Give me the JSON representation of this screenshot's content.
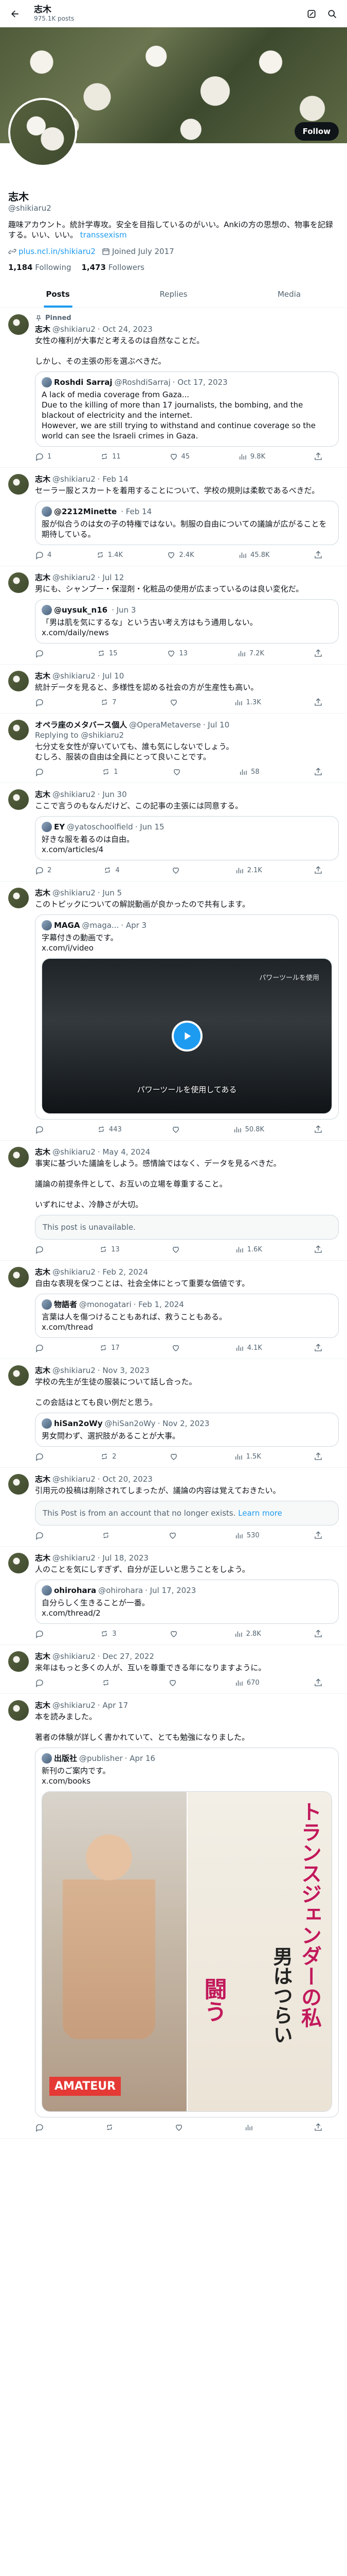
{
  "header": {
    "name": "志木",
    "posts_count": "975.1K posts"
  },
  "profile": {
    "name": "志木",
    "handle": "@shikiaru2",
    "follow_label": "Follow",
    "bio": "趣味アカウント。統計学専攻。安全を目指しているのがいい。Ankiの方の思想の、物事を記録する。いい、いい。",
    "bio_link": "transsexism",
    "website": "plus.ncl.in/shikiaru2",
    "joined": "Joined July 2017",
    "following": "1,184",
    "following_label": "Following",
    "followers": "1,473",
    "followers_label": "Followers"
  },
  "tabs": [
    {
      "label": "Posts"
    },
    {
      "label": "Replies"
    },
    {
      "label": "Media"
    }
  ],
  "tweets": [
    {
      "pinned": "Pinned",
      "name": "志木",
      "handle": "@shikiaru2",
      "date": "· Oct 24, 2023",
      "text": "女性の権利が大事だと考えるのは自然なことだ。\n\nしかし、その主張の形を選ぶべきだ。",
      "quote": {
        "name": "Roshdi Sarraj",
        "handle": "@RoshdiSarraj",
        "date": "· Oct 17, 2023",
        "text": "A lack of media coverage from Gaza...\nDue to the killing of more than 17 journalists, the bombing, and the blackout of electricity and the internet.\nHowever, we are still trying to withstand and continue coverage so the world can see the Israeli crimes in Gaza."
      },
      "stats": [
        "1",
        "11",
        "45",
        "9.8K"
      ]
    },
    {
      "name": "志木",
      "handle": "@shikiaru2",
      "date": "· Feb 14",
      "text": "セーラー服とスカートを着用することについて、学校の規則は柔軟であるべきだ。",
      "quote": {
        "name": "@2212Minette",
        "handle": "",
        "date": "· Feb 14",
        "text": "服が似合うのは女の子の特権ではない。制服の自由についての議論が広がることを期待している。"
      },
      "stats": [
        "4",
        "1.4K",
        "2.4K",
        "45.8K"
      ]
    },
    {
      "name": "志木",
      "handle": "@shikiaru2",
      "date": "· Jul 12",
      "text": "男にも、シャンプー・保湿剤・化粧品の使用が広まっているのは良い変化だ。",
      "quote": {
        "name": "@uysuk_n16",
        "handle": "",
        "date": "· Jun 3",
        "text": "「男は肌を気にするな」という古い考え方はもう通用しない。\nx.com/daily/news"
      },
      "stats": [
        "",
        "15",
        "13",
        "7.2K"
      ]
    },
    {
      "name": "志木",
      "handle": "@shikiaru2",
      "date": "· Jul 10",
      "text": "統計データを見ると、多様性を認める社会の方が生産性も高い。",
      "stats": [
        "",
        "7",
        "",
        "1.3K"
      ]
    },
    {
      "name": "オペラ座のメタバース個人",
      "handle": "@OperaMetaverse",
      "date": "· Jul 10",
      "replying": "Replying to @shikiaru2",
      "text": "七分丈を女性が穿いていても、誰も気にしないでしょう。\nむしろ、服装の自由は全員にとって良いことです。",
      "stats": [
        "",
        "1",
        "",
        "58"
      ]
    },
    {
      "name": "志木",
      "handle": "@shikiaru2",
      "date": "· Jun 30",
      "text": "ここで言うのもなんだけど、この記事の主張には同意する。",
      "quote": {
        "name": "EY",
        "handle": "@yatoschoolfield",
        "date": "· Jun 15",
        "text": "好きな服を着るのは自由。\nx.com/articles/4"
      },
      "stats": [
        "2",
        "4",
        "",
        "2.1K"
      ]
    },
    {
      "name": "志木",
      "handle": "@shikiaru2",
      "date": "· Jun 5",
      "text": "このトピックについての解説動画が良かったので共有します。",
      "quote": {
        "name": "MAGA",
        "handle": "@maga...",
        "date": "· Apr 3",
        "text": "字幕付きの動画です。\nx.com/i/video"
      },
      "video": {
        "sub": "パワーツールを使用してある",
        "sub_r": "パワーツールを使用"
      },
      "stats": [
        "",
        "443",
        "",
        "50.8K"
      ]
    },
    {
      "name": "志木",
      "handle": "@shikiaru2",
      "date": "· May 4, 2024",
      "text": "事実に基づいた議論をしよう。感情論ではなく、データを見るべきだ。\n\n議論の前提条件として、お互いの立場を尊重すること。\n\nいずれにせよ、冷静さが大切。",
      "unavail": "This post is unavailable.",
      "stats": [
        "",
        "13",
        "",
        "1.6K"
      ]
    },
    {
      "name": "志木",
      "handle": "@shikiaru2",
      "date": "· Feb 2, 2024",
      "text": "自由な表現を保つことは、社会全体にとって重要な価値です。",
      "quote": {
        "name": "物語者",
        "handle": "@monogatari",
        "date": "· Feb 1, 2024",
        "text": "言葉は人を傷つけることもあれば、救うこともある。\nx.com/thread"
      },
      "stats": [
        "",
        "17",
        "",
        "4.1K"
      ]
    },
    {
      "name": "志木",
      "handle": "@shikiaru2",
      "date": "· Nov 3, 2023",
      "text": "学校の先生が生徒の服装について話し合った。\n\nこの会話はとても良い例だと思う。",
      "quote": {
        "name": "hiSan2oWy",
        "handle": "@hiSan2oWy",
        "date": "· Nov 2, 2023",
        "text": "男女問わず、選択肢があることが大事。"
      },
      "stats": [
        "",
        "2",
        "",
        "1.5K"
      ]
    },
    {
      "name": "志木",
      "handle": "@shikiaru2",
      "date": "· Oct 20, 2023",
      "text": "引用元の投稿は削除されてしまったが、議論の内容は覚えておきたい。",
      "unavail": "This Post is from an account that no longer exists.",
      "unavail_link": "Learn more",
      "stats": [
        "",
        "",
        "",
        "530"
      ]
    },
    {
      "name": "志木",
      "handle": "@shikiaru2",
      "date": "· Jul 18, 2023",
      "text": "人のことを気にしすぎず、自分が正しいと思うことをしよう。",
      "quote": {
        "name": "ohirohara",
        "handle": "@ohirohara",
        "date": "· Jul 17, 2023",
        "text": "自分らしく生きることが一番。\nx.com/thread/2"
      },
      "stats": [
        "",
        "3",
        "",
        "2.8K"
      ]
    },
    {
      "name": "志木",
      "handle": "@shikiaru2",
      "date": "· Dec 27, 2022",
      "text": "来年はもっと多くの人が、互いを尊重できる年になりますように。",
      "stats": [
        "",
        "",
        "",
        "670"
      ]
    },
    {
      "name": "志木",
      "handle": "@shikiaru2",
      "date": "· Apr 17",
      "text": "本を読みました。\n\n著者の体験が詳しく書かれていて、とても勉強になりました。",
      "quote": {
        "name": "出版社",
        "handle": "@publisher",
        "date": "· Apr 16",
        "text": "新刊のご案内です。\nx.com/books"
      },
      "book": {
        "t1": "トランスジェンダーの私",
        "t2": "男はつらい",
        "badge": "AMATEUR",
        "t3": "闘う"
      },
      "stats": [
        "",
        "",
        "",
        ""
      ]
    }
  ]
}
